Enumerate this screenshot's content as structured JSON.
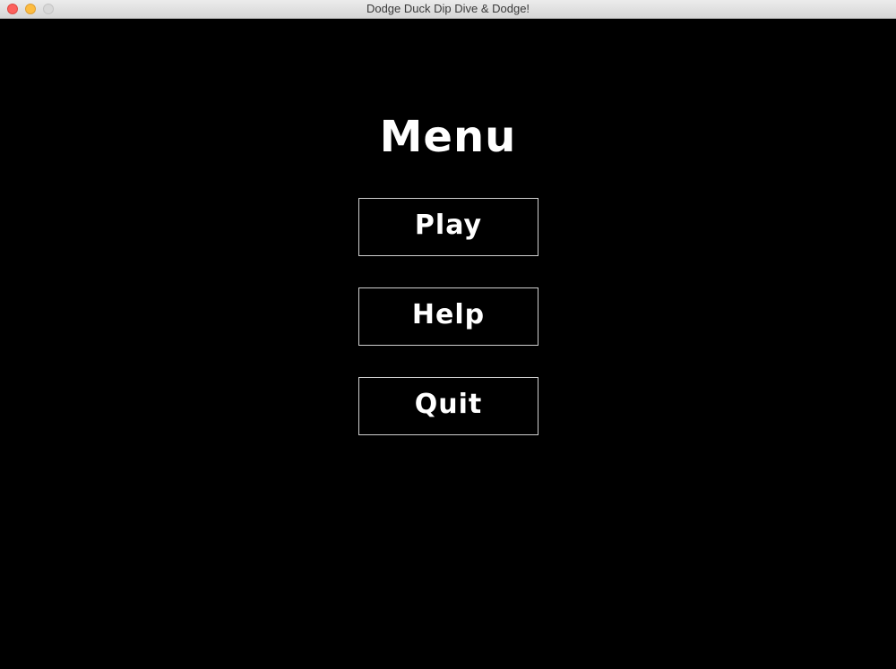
{
  "window": {
    "title": "Dodge Duck Dip Dive & Dodge!"
  },
  "menu": {
    "title": "Menu",
    "buttons": [
      {
        "label": "Play"
      },
      {
        "label": "Help"
      },
      {
        "label": "Quit"
      }
    ]
  },
  "colors": {
    "background": "#000000",
    "text": "#ffffff",
    "button_border": "#d0d0d0",
    "close": "#fc605c",
    "minimize": "#fdbc40",
    "zoom": "#d8d8d8"
  }
}
